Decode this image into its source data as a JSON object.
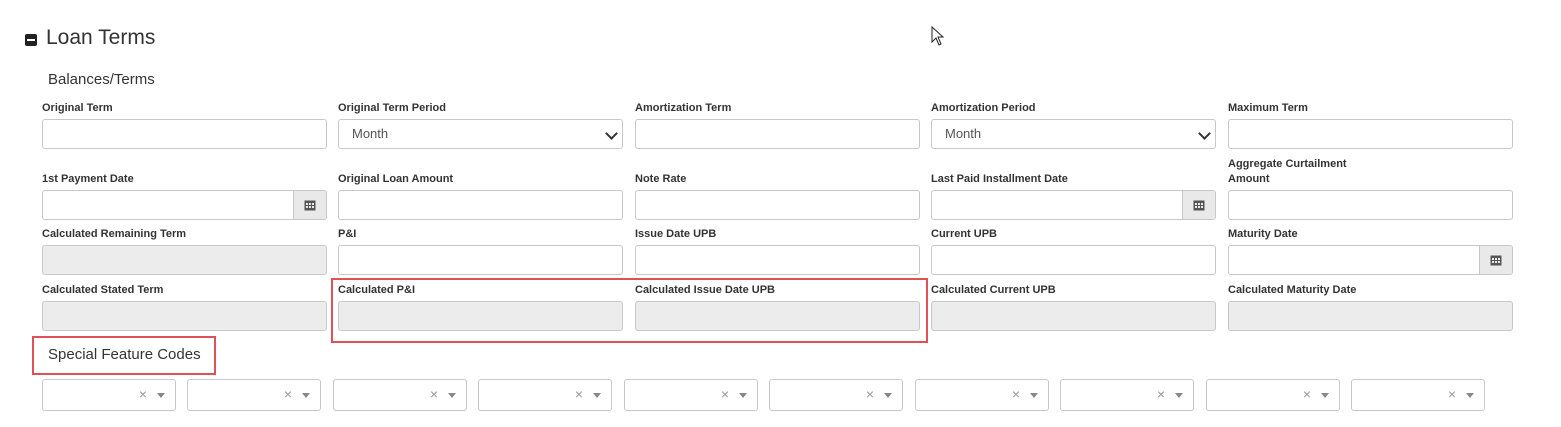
{
  "section": {
    "title": "Loan Terms",
    "toggle_icon": "minus-square-icon"
  },
  "balances": {
    "title": "Balances/Terms",
    "rows": [
      [
        {
          "label": "Original Term",
          "value": ""
        },
        {
          "label": "Original Term Period",
          "value": "Month"
        },
        {
          "label": "Amortization Term",
          "value": ""
        },
        {
          "label": "Amortization Period",
          "value": "Month"
        },
        {
          "label": "Maximum Term",
          "value": ""
        }
      ],
      [
        {
          "label": "1st Payment Date",
          "value": ""
        },
        {
          "label": "Original Loan Amount",
          "value": ""
        },
        {
          "label": "Note Rate",
          "value": ""
        },
        {
          "label": "Last Paid Installment Date",
          "value": ""
        },
        {
          "label": "Aggregate Curtailment Amount",
          "value": ""
        }
      ],
      [
        {
          "label": "Calculated Remaining Term",
          "value": ""
        },
        {
          "label": "P&I",
          "value": ""
        },
        {
          "label": "Issue Date UPB",
          "value": ""
        },
        {
          "label": "Current UPB",
          "value": ""
        },
        {
          "label": "Maturity Date",
          "value": ""
        }
      ],
      [
        {
          "label": "Calculated Stated Term",
          "value": ""
        },
        {
          "label": "Calculated P&I",
          "value": ""
        },
        {
          "label": "Calculated Issue Date UPB",
          "value": ""
        },
        {
          "label": "Calculated Current UPB",
          "value": ""
        },
        {
          "label": "Calculated Maturity Date",
          "value": ""
        }
      ]
    ]
  },
  "special_features": {
    "title": "Special Feature Codes",
    "selects": [
      "",
      "",
      "",
      "",
      "",
      "",
      "",
      "",
      "",
      ""
    ],
    "clear_glyph": "×"
  },
  "colors": {
    "highlight": "#e05155",
    "readonly_bg": "#ececec"
  }
}
